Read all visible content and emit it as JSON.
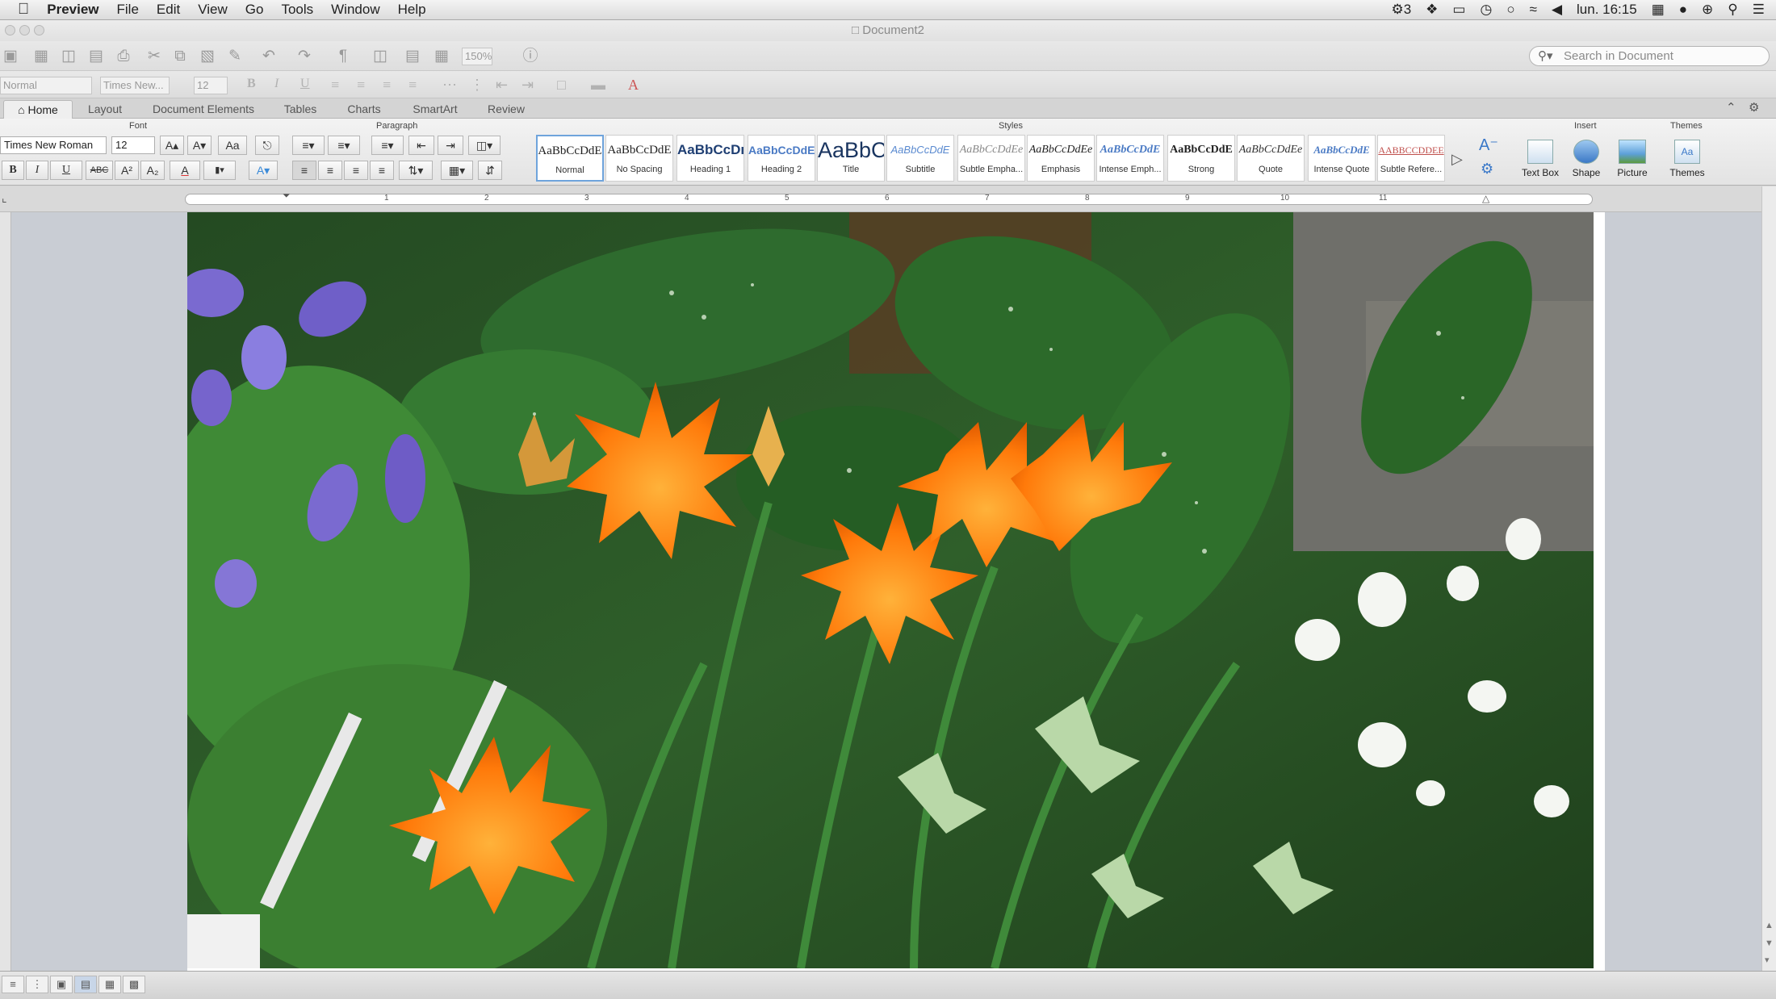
{
  "menubar": {
    "app_name": "Preview",
    "items": [
      "File",
      "Edit",
      "View",
      "Go",
      "Tools",
      "Window",
      "Help"
    ],
    "status": {
      "input_indicator": "3",
      "clock": "lun. 16:15"
    }
  },
  "window": {
    "title": "Document2"
  },
  "toolbar": {
    "zoom": "150%",
    "search_placeholder": "Search in Document"
  },
  "format_bar": {
    "style": "Normal",
    "font": "Times New...",
    "size": "12",
    "bold": "B",
    "italic": "I",
    "underline": "U"
  },
  "tabs": [
    "Home",
    "Layout",
    "Document Elements",
    "Tables",
    "Charts",
    "SmartArt",
    "Review"
  ],
  "active_tab": "Home",
  "ribbon": {
    "groups": {
      "font": "Font",
      "paragraph": "Paragraph",
      "styles": "Styles",
      "insert": "Insert",
      "themes": "Themes"
    },
    "font_name": "Times New Roman",
    "font_size": "12",
    "format_buttons": {
      "bold": "B",
      "italic": "I",
      "underline": "U",
      "strikethrough": "ABC",
      "superscript": "A²",
      "subscript": "A₂",
      "font_color": "A"
    },
    "styles": [
      {
        "preview": "AaBbCcDdE",
        "label": "Normal"
      },
      {
        "preview": "AaBbCcDdE",
        "label": "No Spacing"
      },
      {
        "preview": "AaBbCcDı",
        "label": "Heading 1"
      },
      {
        "preview": "AaBbCcDdE",
        "label": "Heading 2"
      },
      {
        "preview": "AaBbC",
        "label": "Title"
      },
      {
        "preview": "AaBbCcDdE",
        "label": "Subtitle"
      },
      {
        "preview": "AaBbCcDdEe",
        "label": "Subtle Empha..."
      },
      {
        "preview": "AaBbCcDdEe",
        "label": "Emphasis"
      },
      {
        "preview": "AaBbCcDdE",
        "label": "Intense Emph..."
      },
      {
        "preview": "AaBbCcDdE",
        "label": "Strong"
      },
      {
        "preview": "AaBbCcDdEe",
        "label": "Quote"
      },
      {
        "preview": "AaBbCcDdE",
        "label": "Intense Quote"
      },
      {
        "preview": "AABBCCDDEE",
        "label": "Subtle Refere..."
      }
    ],
    "insert": [
      {
        "label": "Text Box"
      },
      {
        "label": "Shape"
      },
      {
        "label": "Picture"
      }
    ],
    "themes": {
      "label": "Themes",
      "preview": "Aa"
    }
  },
  "ruler": {
    "numbers": [
      "1",
      "2",
      "3",
      "4",
      "5",
      "6",
      "7",
      "8",
      "9",
      "10",
      "11"
    ]
  },
  "status_bar": {
    "view_buttons": [
      "draft",
      "outline",
      "publishing",
      "print",
      "notebook",
      "focus"
    ],
    "active_view": "print"
  },
  "colors": {
    "accent": "#6fa4dc",
    "menubar": "#e8e8e8",
    "canvas": "#c9cdd4"
  }
}
